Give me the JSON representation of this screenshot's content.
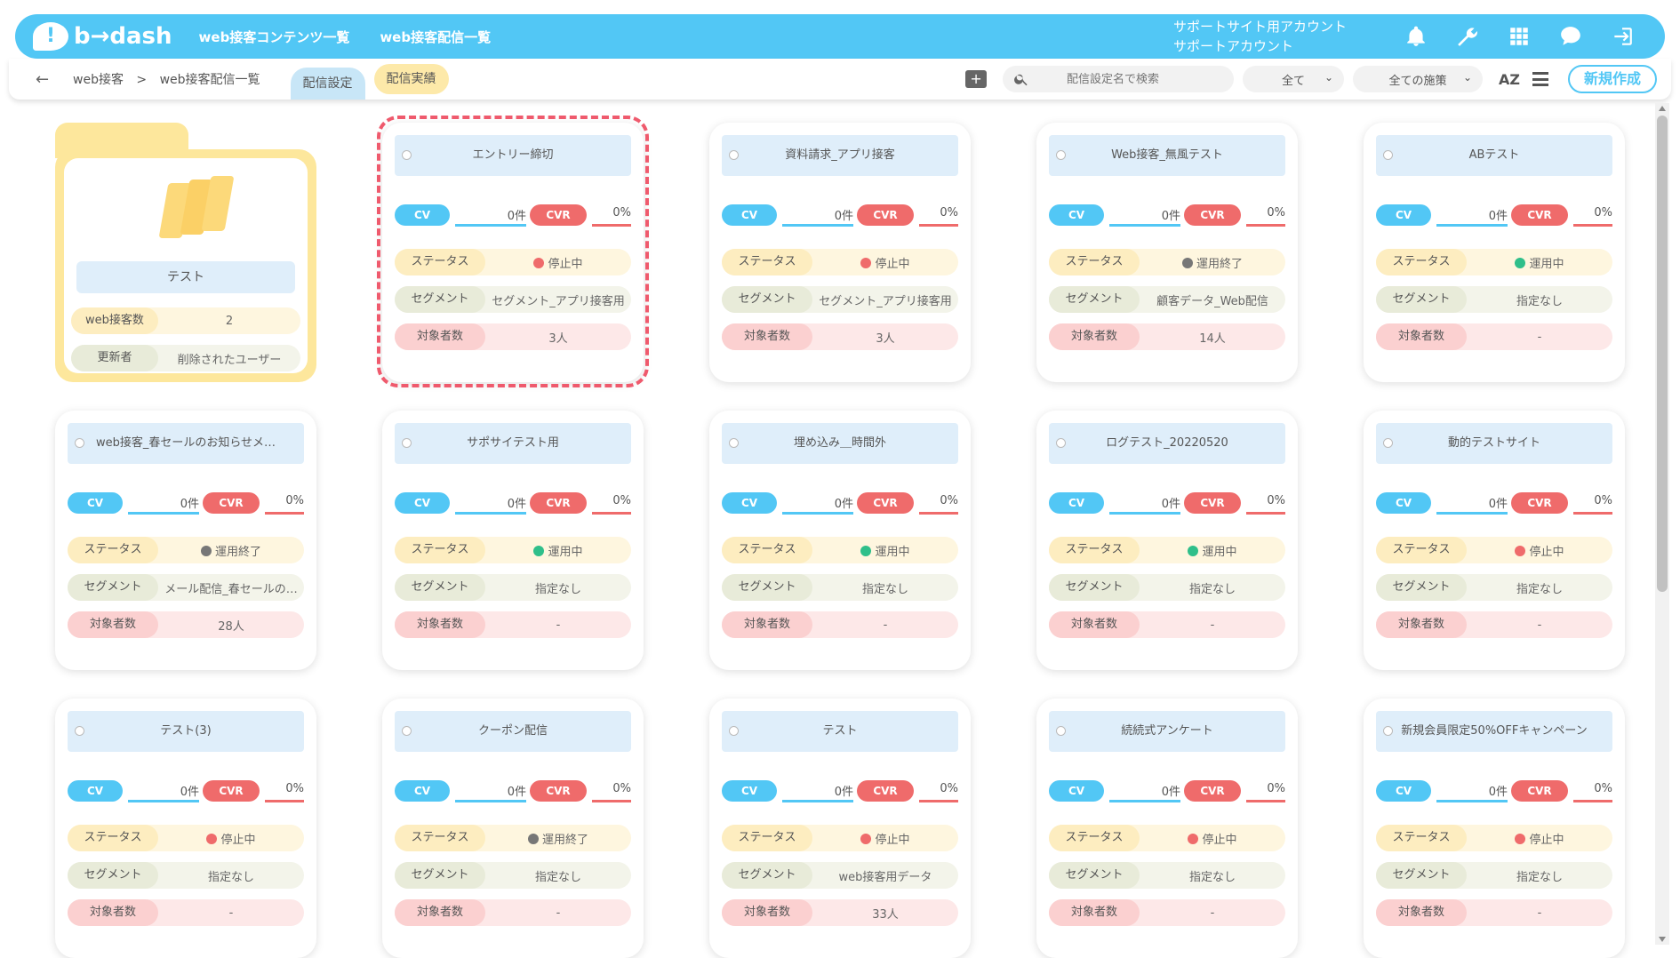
{
  "app": {
    "logo_text": "b→dash",
    "nav": [
      "web接客コンテンツ一覧",
      "web接客配信一覧"
    ],
    "account_line1": "サポートサイト用アカウント",
    "account_line2": "サポートアカウント"
  },
  "subbar": {
    "breadcrumb_root": "web接客",
    "breadcrumb_sep": ">",
    "breadcrumb_current": "web接客配信一覧",
    "tab_settings": "配信設定",
    "tab_results": "配信実績",
    "search_placeholder": "配信設定名で検索",
    "filter_all": "全て",
    "filter_measures": "全ての施策",
    "sort_label": "AZ",
    "new_button": "新規作成"
  },
  "folder": {
    "name": "テスト",
    "rows": [
      {
        "label": "web接客数",
        "value": "2"
      },
      {
        "label": "更新者",
        "value": "削除されたユーザー"
      }
    ]
  },
  "labels": {
    "cv": "CV",
    "cvr": "CVR",
    "status": "ステータス",
    "segment": "セグメント",
    "target": "対象者数"
  },
  "cards": [
    {
      "title": "エントリー締切",
      "cv": "0件",
      "cvr": "0%",
      "status": "停止中",
      "status_type": "stop",
      "segment": "セグメント_アプリ接客用",
      "target": "3人"
    },
    {
      "title": "資料請求_アプリ接客",
      "cv": "0件",
      "cvr": "0%",
      "status": "停止中",
      "status_type": "stop",
      "segment": "セグメント_アプリ接客用",
      "target": "3人"
    },
    {
      "title": "Web接客_無風テスト",
      "cv": "0件",
      "cvr": "0%",
      "status": "運用終了",
      "status_type": "end",
      "segment": "顧客データ_Web配信",
      "target": "14人"
    },
    {
      "title": "ABテスト",
      "cv": "0件",
      "cvr": "0%",
      "status": "運用中",
      "status_type": "run",
      "segment": "指定なし",
      "target": "-"
    },
    {
      "title": "web接客_春セールのお知らせメ…",
      "cv": "0件",
      "cvr": "0%",
      "status": "運用終了",
      "status_type": "end",
      "segment": "メール配信_春セールの…",
      "target": "28人"
    },
    {
      "title": "サポサイテスト用",
      "cv": "0件",
      "cvr": "0%",
      "status": "運用中",
      "status_type": "run",
      "segment": "指定なし",
      "target": "-"
    },
    {
      "title": "埋め込み＿時間外",
      "cv": "0件",
      "cvr": "0%",
      "status": "運用中",
      "status_type": "run",
      "segment": "指定なし",
      "target": "-"
    },
    {
      "title": "ログテスト_20220520",
      "cv": "0件",
      "cvr": "0%",
      "status": "運用中",
      "status_type": "run",
      "segment": "指定なし",
      "target": "-"
    },
    {
      "title": "動的テストサイト",
      "cv": "0件",
      "cvr": "0%",
      "status": "停止中",
      "status_type": "stop",
      "segment": "指定なし",
      "target": "-"
    },
    {
      "title": "テスト(3)",
      "cv": "0件",
      "cvr": "0%",
      "status": "停止中",
      "status_type": "stop",
      "segment": "指定なし",
      "target": "-"
    },
    {
      "title": "クーポン配信",
      "cv": "0件",
      "cvr": "0%",
      "status": "運用終了",
      "status_type": "end",
      "segment": "指定なし",
      "target": "-"
    },
    {
      "title": "テスト",
      "cv": "0件",
      "cvr": "0%",
      "status": "停止中",
      "status_type": "stop",
      "segment": "web接客用データ",
      "target": "33人"
    },
    {
      "title": "続続式アンケート",
      "cv": "0件",
      "cvr": "0%",
      "status": "停止中",
      "status_type": "stop",
      "segment": "指定なし",
      "target": "-"
    },
    {
      "title": "新規会員限定50%OFFキャンペーン",
      "cv": "0件",
      "cvr": "0%",
      "status": "停止中",
      "status_type": "stop",
      "segment": "指定なし",
      "target": "-"
    }
  ],
  "colors": {
    "brand": "#52c7f5",
    "cvr": "#ef6b6b",
    "folder": "#fde79c",
    "highlight": "#ef5a6d"
  }
}
